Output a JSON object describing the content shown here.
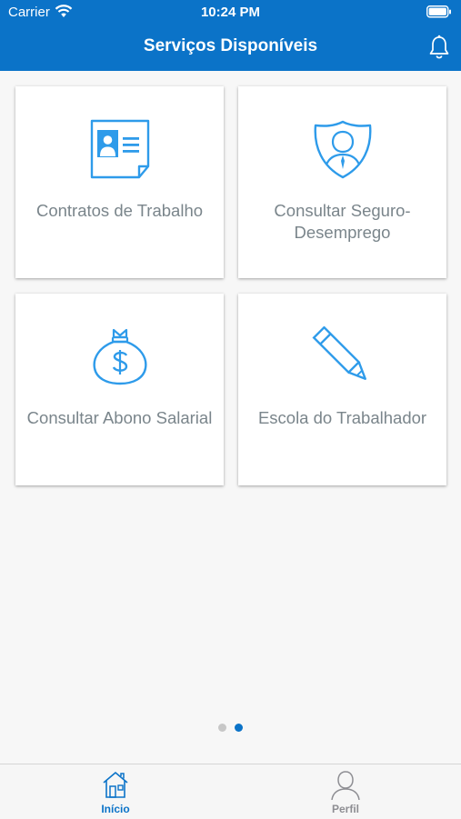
{
  "status_bar": {
    "carrier": "Carrier",
    "time": "10:24 PM"
  },
  "navbar": {
    "title": "Serviços Disponíveis",
    "icon": "bell-icon"
  },
  "cards": [
    {
      "label": "Contratos de Trabalho",
      "icon": "id-card-document-icon"
    },
    {
      "label": "Consultar Seguro-Desemprego",
      "icon": "person-shield-icon"
    },
    {
      "label": "Consultar Abono Salarial",
      "icon": "money-bag-icon"
    },
    {
      "label": "Escola do Trabalhador",
      "icon": "pencil-icon"
    }
  ],
  "pager": {
    "pages": 2,
    "current": 2
  },
  "tab_bar": {
    "tabs": [
      {
        "label": "Início",
        "icon": "house-icon",
        "active": true
      },
      {
        "label": "Perfil",
        "icon": "person-outline-icon",
        "active": false
      }
    ]
  },
  "colors": {
    "primary": "#0b73c8",
    "icon_blue": "#2e9bea",
    "card_text": "#7a858b",
    "inactive": "#8e8e93"
  }
}
